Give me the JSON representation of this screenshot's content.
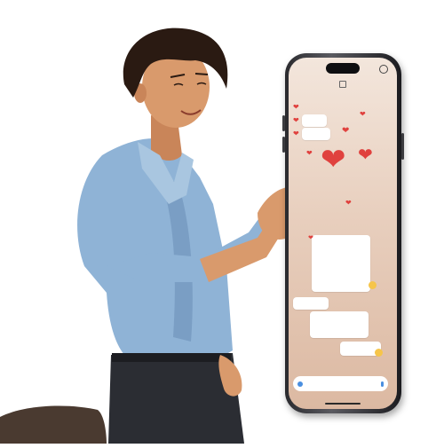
{
  "scene": {
    "background_color": "#ffffff",
    "skin_color": "#d99a6c",
    "hair_color": "#2a1a12",
    "shirt_color": "#8fb3d6",
    "jeans_color": "#2b2d33",
    "couch_color": "#4a3a30"
  },
  "phone": {
    "app_title": "",
    "contact_name": "",
    "messages": [
      {
        "side": "left",
        "text": "",
        "icon": "heart-icon"
      },
      {
        "side": "left",
        "text": "",
        "icon": "heart-icon"
      },
      {
        "side": "left",
        "text": "",
        "icon": "heart-icon"
      },
      {
        "side": "right",
        "text": ""
      },
      {
        "side": "left",
        "text": ""
      },
      {
        "side": "right",
        "text": ""
      },
      {
        "side": "right",
        "text": ""
      }
    ],
    "input_placeholder": "",
    "accent_color": "#e0413e",
    "bubble_color": "#ffffff"
  }
}
